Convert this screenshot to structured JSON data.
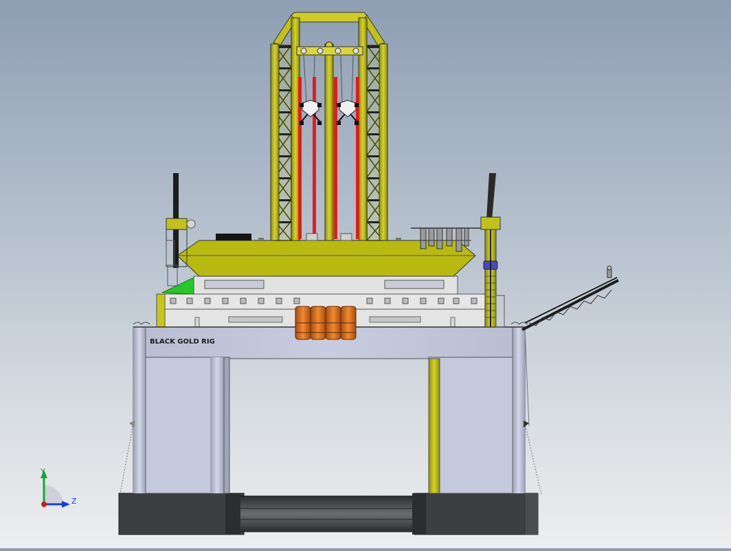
{
  "model": {
    "hull_label": "BLACK GOLD RIG"
  },
  "triad": {
    "y_label": "Y",
    "z_label": "Z"
  },
  "colors": {
    "hull": "#c5c9dc",
    "pontoon": "#3a3d3e",
    "derrick_yellow": "#c2c11a",
    "deck_yellow": "#b9ba10",
    "riser_red": "#e01d1d",
    "lifeboat_orange": "#e2741b",
    "helideck_green": "#27c727",
    "axis_y": "#1fa03b",
    "axis_z": "#1a3fd6",
    "axis_x": "#d11a1a"
  }
}
